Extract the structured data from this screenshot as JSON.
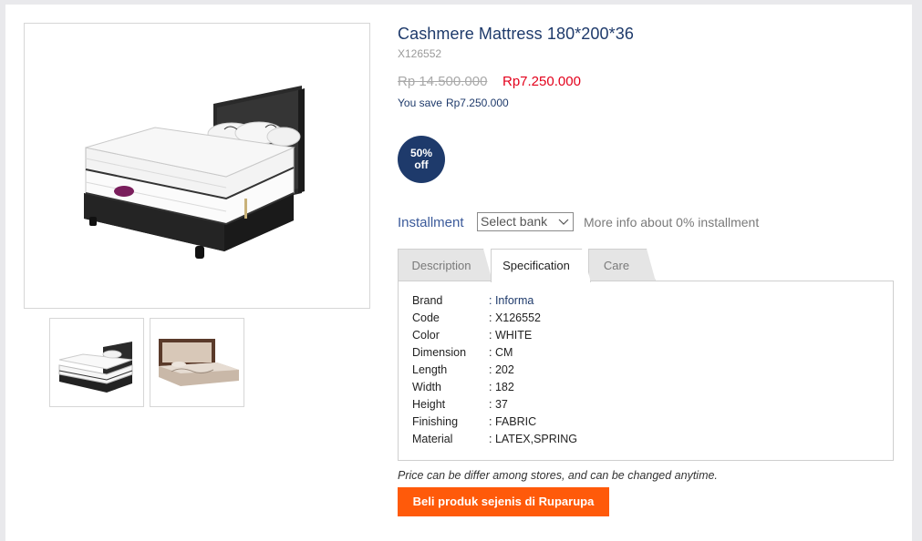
{
  "product": {
    "title": "Cashmere Mattress 180*200*36",
    "sku": "X126552",
    "old_price": "Rp 14.500.000",
    "new_price": "Rp7.250.000",
    "you_save_label": "You save",
    "you_save_amount": "Rp7.250.000",
    "badge_line1": "50%",
    "badge_line2": "off"
  },
  "installment": {
    "label": "Installment",
    "select_value": "Select bank",
    "info_link": "More info about 0% installment"
  },
  "tabs": [
    {
      "label": "Description",
      "active": false
    },
    {
      "label": "Specification",
      "active": true
    },
    {
      "label": "Care",
      "active": false
    }
  ],
  "specs": [
    {
      "key": "Brand",
      "value": ": Informa"
    },
    {
      "key": "Code",
      "value": ": X126552"
    },
    {
      "key": "Color",
      "value": ": WHITE"
    },
    {
      "key": "Dimension",
      "value": ": CM"
    },
    {
      "key": "Length",
      "value": ": 202"
    },
    {
      "key": "Width",
      "value": ": 182"
    },
    {
      "key": "Height",
      "value": ": 37"
    },
    {
      "key": "Finishing",
      "value": ": FABRIC"
    },
    {
      "key": "Material",
      "value": ": LATEX,SPRING"
    }
  ],
  "note": "Price can be differ among stores, and can be changed anytime.",
  "buy_button": "Beli produk sejenis di Ruparupa",
  "colors": {
    "title": "#1e3a6b",
    "sale_price": "#e3001b",
    "button": "#ff5a0a",
    "badge": "#1e3a6b"
  }
}
